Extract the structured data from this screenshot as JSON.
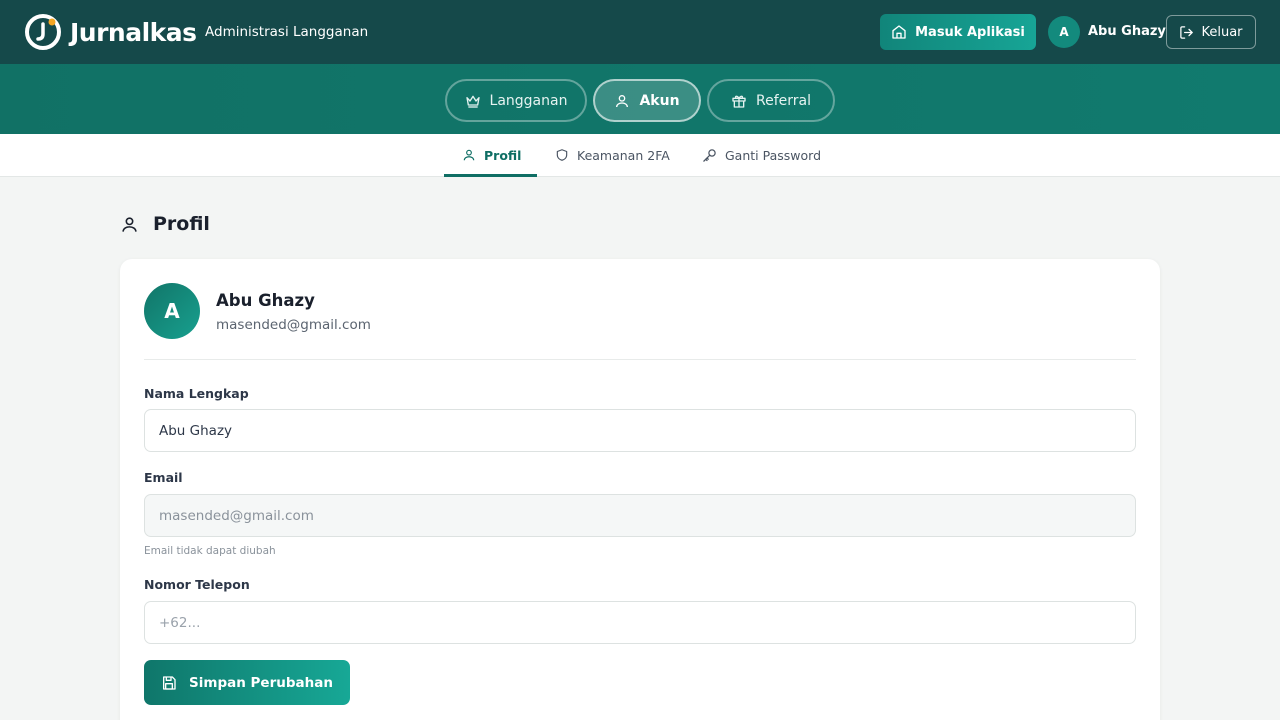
{
  "header": {
    "brand": "Jurnalkas",
    "subtitle": "Administrasi Langganan",
    "enter_app_label": "Masuk Aplikasi",
    "user_initial": "A",
    "user_name": "Abu Ghazy",
    "logout_label": "Keluar"
  },
  "main_tabs": [
    {
      "label": "Langganan",
      "icon": "crown-icon"
    },
    {
      "label": "Akun",
      "icon": "user-icon",
      "active": true
    },
    {
      "label": "Referral",
      "icon": "gift-icon"
    }
  ],
  "sub_tabs": [
    {
      "label": "Profil",
      "icon": "user-icon",
      "active": true
    },
    {
      "label": "Keamanan 2FA",
      "icon": "shield-icon"
    },
    {
      "label": "Ganti Password",
      "icon": "key-icon"
    }
  ],
  "section": {
    "title": "Profil"
  },
  "profile": {
    "initial": "A",
    "name": "Abu Ghazy",
    "email": "masended@gmail.com"
  },
  "form": {
    "full_name": {
      "label": "Nama Lengkap",
      "value": "Abu Ghazy"
    },
    "email": {
      "label": "Email",
      "value": "masended@gmail.com",
      "hint": "Email tidak dapat diubah"
    },
    "phone": {
      "label": "Nomor Telepon",
      "placeholder": "+62..."
    },
    "save_label": "Simpan Perubahan"
  },
  "colors": {
    "header_bg": "#15494a",
    "band_bg": "#117165",
    "accent": "#0f6e64",
    "button_gradient_start": "#0f766a",
    "button_gradient_end": "#17a896"
  }
}
